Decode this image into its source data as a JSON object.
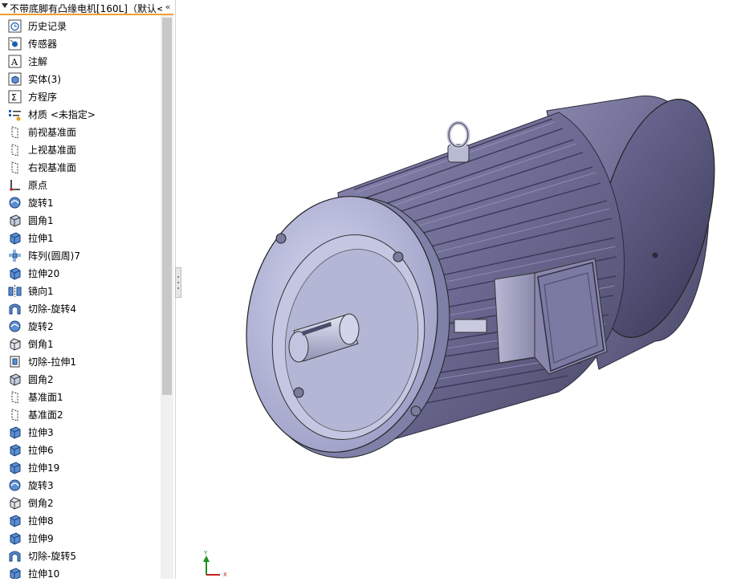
{
  "feature_tree": {
    "title": "不带底脚有凸缘电机[160L]（默认<",
    "items": [
      {
        "label": "历史记录",
        "icon": "history-icon"
      },
      {
        "label": "传感器",
        "icon": "sensor-icon"
      },
      {
        "label": "注解",
        "icon": "annotation-icon"
      },
      {
        "label": "实体(3)",
        "icon": "solid-body-icon"
      },
      {
        "label": "方程序",
        "icon": "equation-icon"
      },
      {
        "label": "材质 <未指定>",
        "icon": "material-icon"
      },
      {
        "label": "前视基准面",
        "icon": "plane-icon"
      },
      {
        "label": "上视基准面",
        "icon": "plane-icon"
      },
      {
        "label": "右视基准面",
        "icon": "plane-icon"
      },
      {
        "label": "原点",
        "icon": "origin-icon"
      },
      {
        "label": "旋转1",
        "icon": "revolve-icon"
      },
      {
        "label": "圆角1",
        "icon": "fillet-icon"
      },
      {
        "label": "拉伸1",
        "icon": "extrude-icon"
      },
      {
        "label": "阵列(圆周)7",
        "icon": "circular-pattern-icon"
      },
      {
        "label": "拉伸20",
        "icon": "extrude-icon"
      },
      {
        "label": "镜向1",
        "icon": "mirror-icon"
      },
      {
        "label": "切除-旋转4",
        "icon": "cut-revolve-icon"
      },
      {
        "label": "旋转2",
        "icon": "revolve-icon"
      },
      {
        "label": "倒角1",
        "icon": "chamfer-icon"
      },
      {
        "label": "切除-拉伸1",
        "icon": "cut-extrude-icon"
      },
      {
        "label": "圆角2",
        "icon": "fillet-icon"
      },
      {
        "label": "基准面1",
        "icon": "plane-icon"
      },
      {
        "label": "基准面2",
        "icon": "plane-icon"
      },
      {
        "label": "拉伸3",
        "icon": "extrude-icon"
      },
      {
        "label": "拉伸6",
        "icon": "extrude-icon"
      },
      {
        "label": "拉伸19",
        "icon": "extrude-icon"
      },
      {
        "label": "旋转3",
        "icon": "revolve-icon"
      },
      {
        "label": "倒角2",
        "icon": "chamfer-icon"
      },
      {
        "label": "拉伸8",
        "icon": "extrude-icon"
      },
      {
        "label": "拉伸9",
        "icon": "extrude-icon"
      },
      {
        "label": "切除-旋转5",
        "icon": "cut-revolve-icon"
      },
      {
        "label": "拉伸10",
        "icon": "extrude-icon"
      }
    ]
  },
  "viewport": {
    "model": "flange-mounted-motor",
    "axis_triad": {
      "y_label": "Y",
      "x_label": "X"
    }
  },
  "colors": {
    "header_accent": "#f0a030",
    "motor_body": "#6a6890",
    "flange": "#aeb0d2",
    "shaft": "#b8bcd6"
  }
}
